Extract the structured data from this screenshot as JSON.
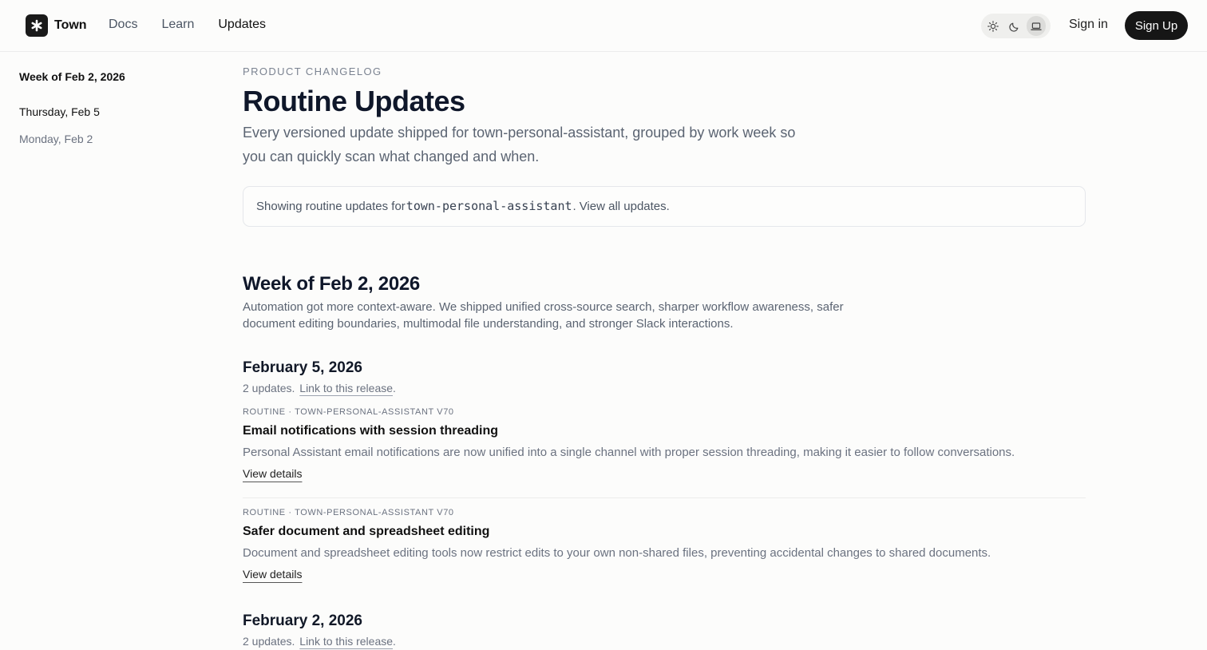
{
  "header": {
    "brand": "Town",
    "nav": [
      "Docs",
      "Learn",
      "Updates"
    ],
    "active_nav": "Updates",
    "theme_options": [
      "light",
      "dark",
      "system"
    ],
    "selected_theme": "system",
    "sign_in": "Sign in",
    "sign_up": "Sign Up"
  },
  "sidebar": {
    "week": "Week of Feb 2, 2026",
    "days": [
      "Thursday, Feb 5",
      "Monday, Feb 2"
    ]
  },
  "main": {
    "eyebrow": "PRODUCT CHANGELOG",
    "title": "Routine Updates",
    "subtitle": "Every versioned update shipped for town-personal-assistant, grouped by work week so you can quickly scan what changed and when.",
    "notice": {
      "prefix": "Showing routine updates for",
      "code": "town-personal-assistant",
      "suffix": ".",
      "link": "View all updates."
    },
    "week": {
      "title": "Week of Feb 2, 2026",
      "description": "Automation got more context-aware. We shipped unified cross-source search, sharper workflow awareness, safer document editing boundaries, multimodal file understanding, and stronger Slack interactions."
    },
    "days": [
      {
        "title": "February 5, 2026",
        "count": "2 updates.",
        "link": "Link to this release",
        "entries": [
          {
            "tag": "ROUTINE · TOWN-PERSONAL-ASSISTANT V70",
            "title": "Email notifications with session threading",
            "description": "Personal Assistant email notifications are now unified into a single channel with proper session threading, making it easier to follow conversations.",
            "details": "View details"
          },
          {
            "tag": "ROUTINE · TOWN-PERSONAL-ASSISTANT V70",
            "title": "Safer document and spreadsheet editing",
            "description": "Document and spreadsheet editing tools now restrict edits to your own non-shared files, preventing accidental changes to shared documents.",
            "details": "View details"
          }
        ]
      },
      {
        "title": "February 2, 2026",
        "count": "2 updates.",
        "link": "Link to this release"
      }
    ]
  }
}
